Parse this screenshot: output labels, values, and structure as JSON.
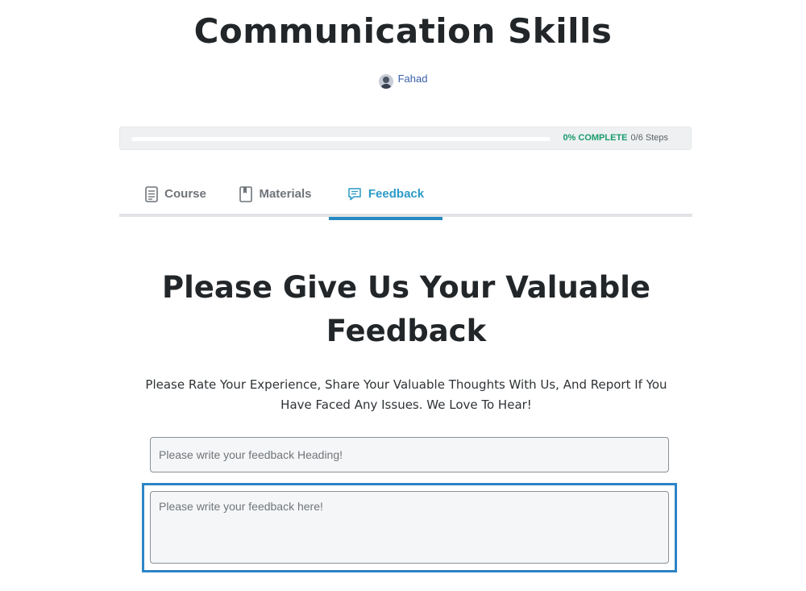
{
  "course": {
    "title": "Communication Skills",
    "author": "Fahad"
  },
  "progress": {
    "percent_label": "0% COMPLETE",
    "steps_label": "0/6 Steps",
    "fraction": 0
  },
  "tabs": [
    {
      "label": "Course",
      "icon": "document-icon",
      "active": false
    },
    {
      "label": "Materials",
      "icon": "book-icon",
      "active": false
    },
    {
      "label": "Feedback",
      "icon": "chat-bubble-icon",
      "active": true
    }
  ],
  "feedback": {
    "heading": "Please Give Us Your Valuable Feedback",
    "description": "Please Rate Your Experience, Share Your Valuable Thoughts With Us, And Report If You Have Faced Any Issues. We Love To Hear!",
    "heading_placeholder": "Please write your feedback Heading!",
    "body_placeholder": "Please write your feedback here!"
  },
  "colors": {
    "accent": "#2b9ac7",
    "progress": "#1a9b6c",
    "author_link": "#3a5fa7"
  }
}
